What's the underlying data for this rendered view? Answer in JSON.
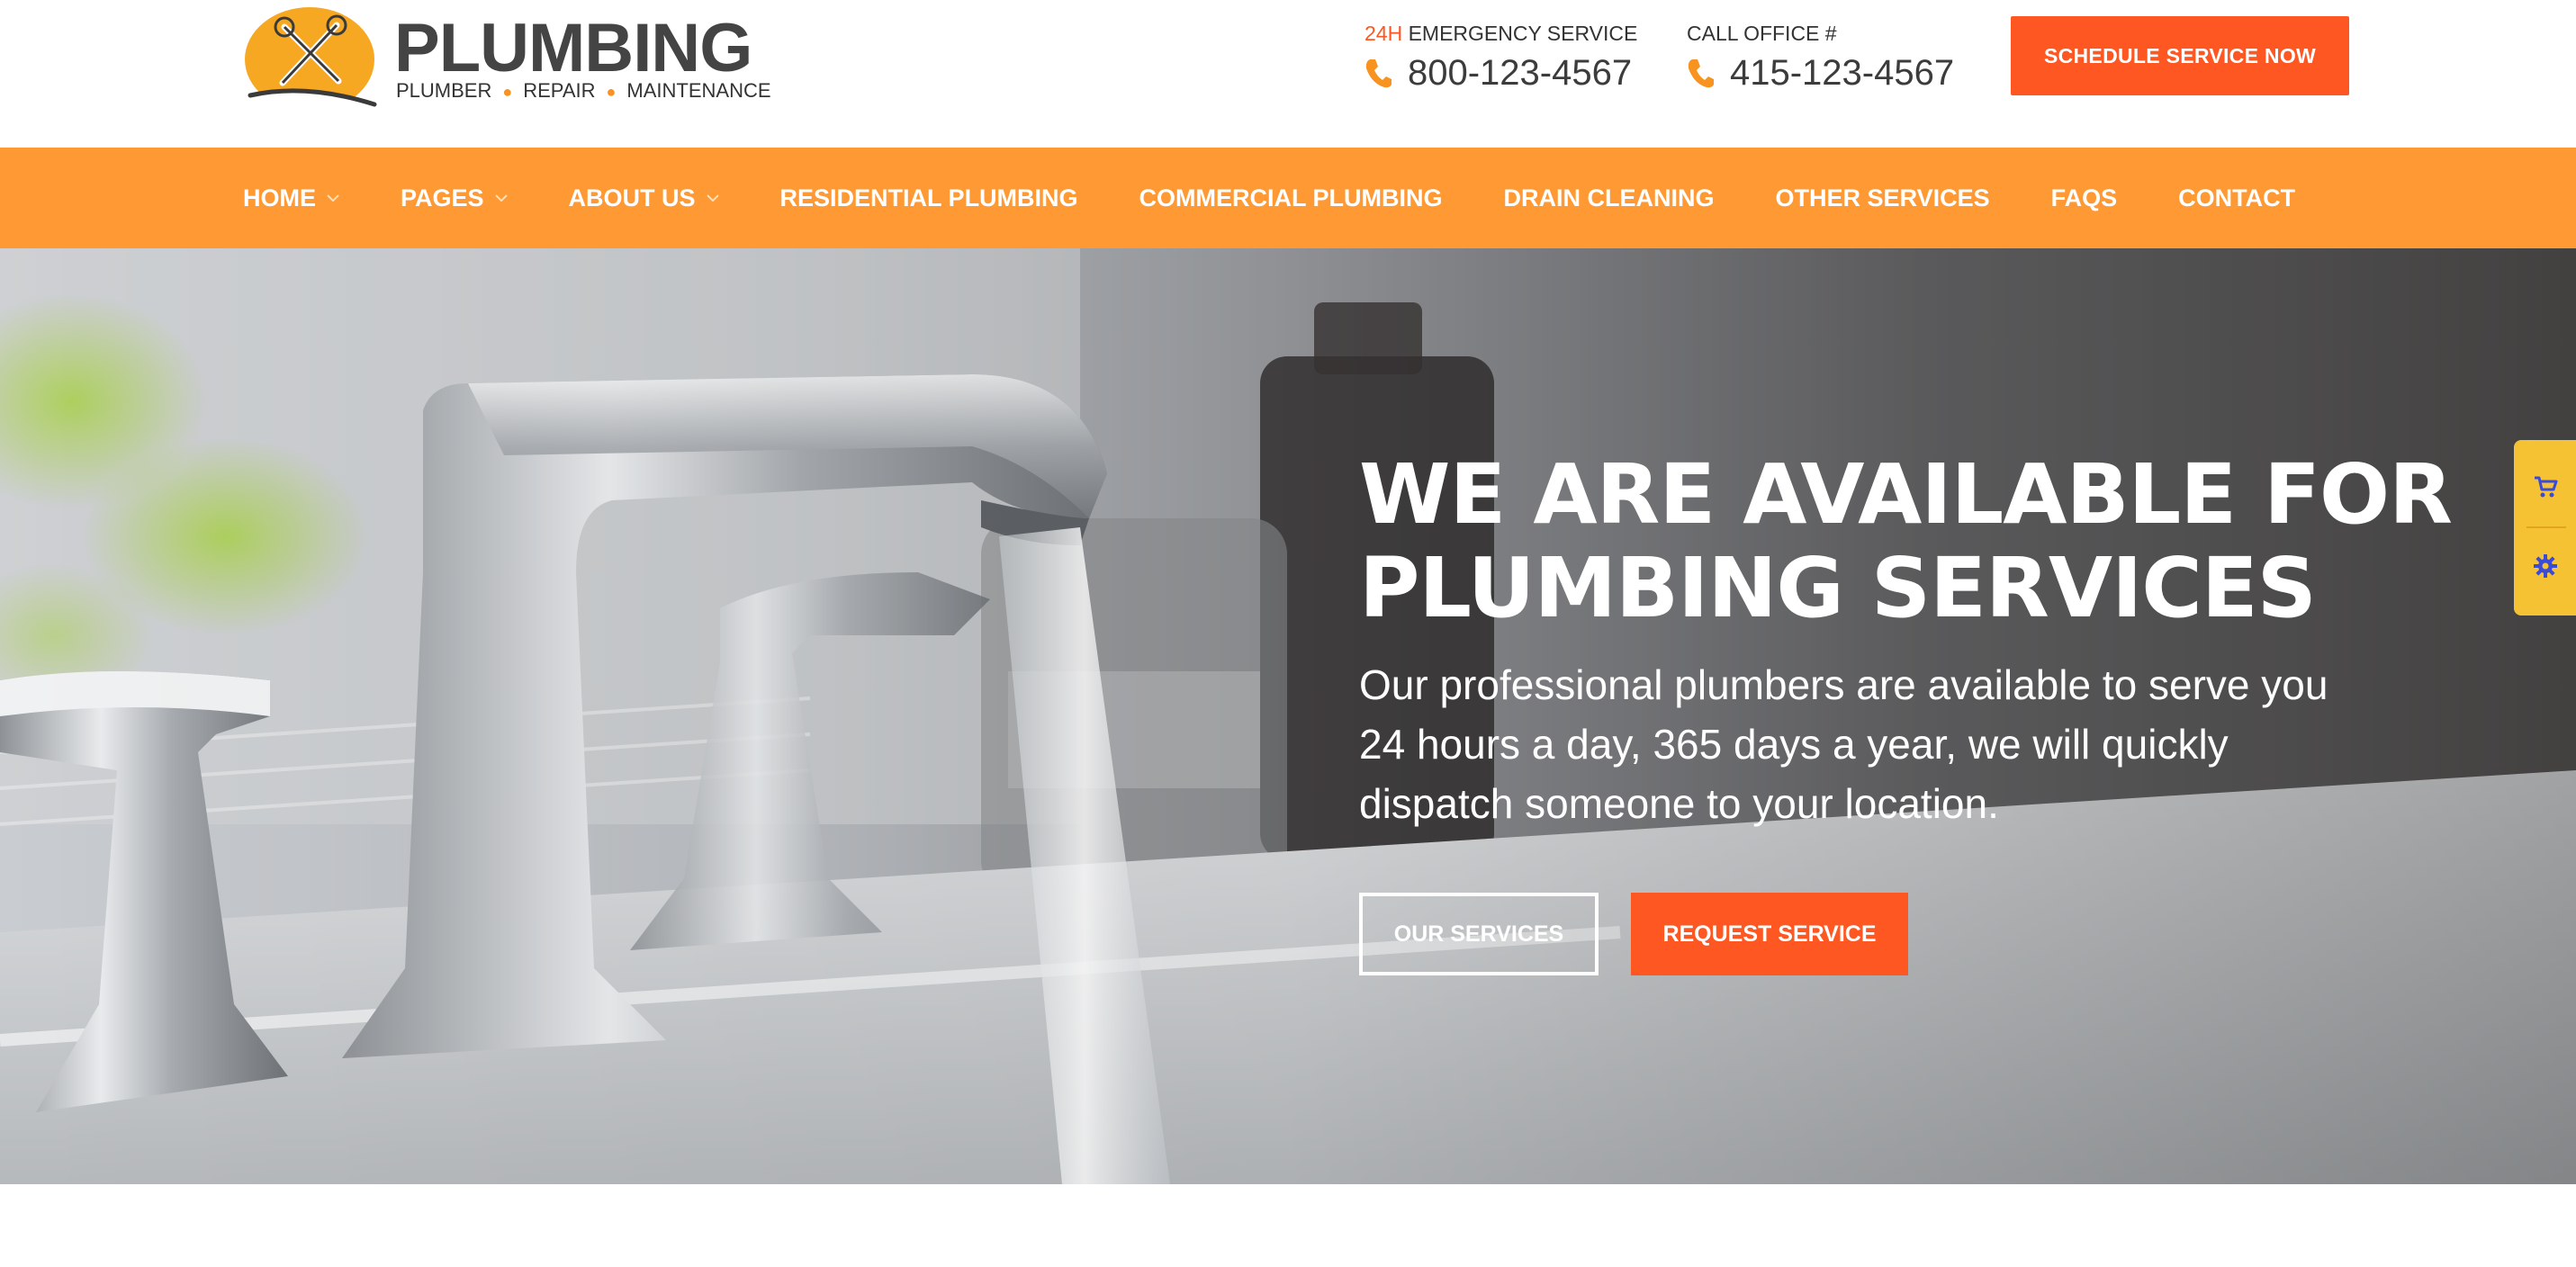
{
  "header": {
    "logo": {
      "title": "PLUMBING",
      "tagline": [
        "PLUMBER",
        "REPAIR",
        "MAINTENANCE"
      ],
      "icon": "wrench-and-pipe-wrench-icon",
      "badge_color": "#f7a823"
    },
    "emergency": {
      "label_highlight": "24H",
      "label": " EMERGENCY SERVICE",
      "phone": "800-123-4567",
      "icon": "phone-icon"
    },
    "office": {
      "label": "CALL OFFICE #",
      "phone": "415-123-4567",
      "icon": "phone-icon"
    },
    "cta_label": "SCHEDULE SERVICE NOW"
  },
  "nav": {
    "items": [
      {
        "label": "HOME",
        "has_dropdown": true
      },
      {
        "label": "PAGES",
        "has_dropdown": true
      },
      {
        "label": "ABOUT US",
        "has_dropdown": true
      },
      {
        "label": "RESIDENTIAL PLUMBING",
        "has_dropdown": false
      },
      {
        "label": "COMMERCIAL PLUMBING",
        "has_dropdown": false
      },
      {
        "label": "DRAIN CLEANING",
        "has_dropdown": false
      },
      {
        "label": "OTHER SERVICES",
        "has_dropdown": false
      },
      {
        "label": "FAQS",
        "has_dropdown": false
      },
      {
        "label": "CONTACT",
        "has_dropdown": false
      }
    ]
  },
  "hero": {
    "heading_line1": "WE ARE AVAILABLE FOR",
    "heading_line2": "PLUMBING SERVICES",
    "subtext": "Our professional plumbers are available to serve you 24 hours a day, 365 days a year, we will quickly dispatch someone to your location.",
    "primary_button": "OUR SERVICES",
    "secondary_button": "REQUEST SERVICE"
  },
  "side_widget": {
    "icons": [
      "cart-icon",
      "gear-icon"
    ]
  },
  "colors": {
    "accent": "#ff5722",
    "nav_background": "#ff9933",
    "widget_background": "#f5c233",
    "widget_icon": "#3b4bd8"
  }
}
